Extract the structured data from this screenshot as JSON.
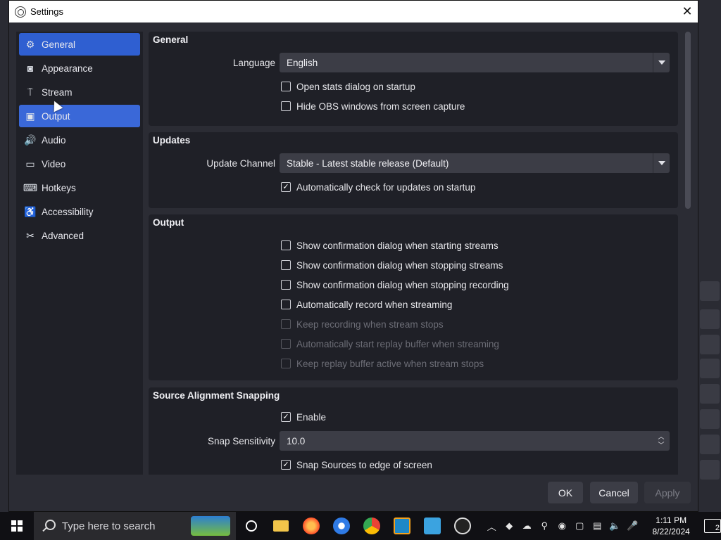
{
  "window": {
    "title": "Settings",
    "close_glyph": "✕"
  },
  "sidebar": {
    "items": [
      {
        "label": "General",
        "icon": "gear-icon",
        "glyph": "⚙"
      },
      {
        "label": "Appearance",
        "icon": "appearance-icon",
        "glyph": "◙"
      },
      {
        "label": "Stream",
        "icon": "stream-antenna-icon",
        "glyph": "⍑"
      },
      {
        "label": "Output",
        "icon": "output-icon",
        "glyph": "▣"
      },
      {
        "label": "Audio",
        "icon": "speaker-icon",
        "glyph": "🔊"
      },
      {
        "label": "Video",
        "icon": "monitor-icon",
        "glyph": "▭"
      },
      {
        "label": "Hotkeys",
        "icon": "keyboard-icon",
        "glyph": "⌨"
      },
      {
        "label": "Accessibility",
        "icon": "accessibility-icon",
        "glyph": "♿"
      },
      {
        "label": "Advanced",
        "icon": "tools-icon",
        "glyph": "✂"
      }
    ],
    "selected": "General",
    "hovered": "Output"
  },
  "general": {
    "title": "General",
    "language_label": "Language",
    "language_value": "English",
    "open_stats_label": "Open stats dialog on startup",
    "open_stats_checked": false,
    "hide_obs_label": "Hide OBS windows from screen capture",
    "hide_obs_checked": false
  },
  "updates": {
    "title": "Updates",
    "channel_label": "Update Channel",
    "channel_value": "Stable - Latest stable release (Default)",
    "auto_check_label": "Automatically check for updates on startup",
    "auto_check_checked": true
  },
  "output": {
    "title": "Output",
    "options": [
      {
        "label": "Show confirmation dialog when starting streams",
        "checked": false,
        "enabled": true
      },
      {
        "label": "Show confirmation dialog when stopping streams",
        "checked": false,
        "enabled": true
      },
      {
        "label": "Show confirmation dialog when stopping recording",
        "checked": false,
        "enabled": true
      },
      {
        "label": "Automatically record when streaming",
        "checked": false,
        "enabled": true
      },
      {
        "label": "Keep recording when stream stops",
        "checked": false,
        "enabled": false
      },
      {
        "label": "Automatically start replay buffer when streaming",
        "checked": false,
        "enabled": false
      },
      {
        "label": "Keep replay buffer active when stream stops",
        "checked": false,
        "enabled": false
      }
    ]
  },
  "snapping": {
    "title": "Source Alignment Snapping",
    "enable_label": "Enable",
    "enable_checked": true,
    "sensitivity_label": "Snap Sensitivity",
    "sensitivity_value": "10.0",
    "snap_edges_label": "Snap Sources to edge of screen",
    "snap_edges_checked": true
  },
  "buttons": {
    "ok": "OK",
    "cancel": "Cancel",
    "apply": "Apply"
  },
  "taskbar": {
    "search_placeholder": "Type here to search",
    "time": "1:11 PM",
    "date": "8/22/2024",
    "notification_count": "2"
  },
  "colors": {
    "accent": "#2f5fd1",
    "dialog_bg": "#2b2c34",
    "panel_bg": "#1f2027"
  }
}
